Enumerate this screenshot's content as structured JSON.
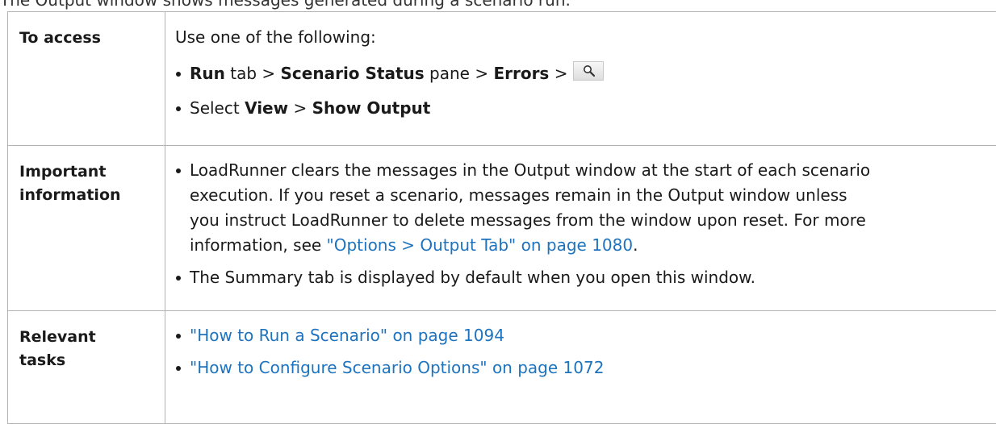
{
  "top_fragment": "The Output window shows messages generated during a scenario run.",
  "rows": {
    "access": {
      "label": "To access",
      "intro": "Use one of the following:",
      "path1": {
        "run": "Run",
        "tab_text": " tab > ",
        "scenario_status": "Scenario Status",
        "pane_text": " pane > ",
        "errors": "Errors",
        "sep": " > "
      },
      "path2": {
        "select": "Select ",
        "view": "View",
        "sep": " > ",
        "show_output": "Show Output"
      }
    },
    "important": {
      "label_1": "Important",
      "label_2": "information",
      "line_1": "LoadRunner clears the messages in the Output window at the start of each scenario",
      "line_2": "execution. If you reset a scenario, messages remain in the Output window unless",
      "line_3": "you instruct LoadRunner to delete messages from the window upon reset. For more",
      "line_4_prefix": "information, see ",
      "line_4_link": "\"Options > Output Tab\" on page 1080",
      "line_4_suffix": ".",
      "bullet_2": "The Summary tab is displayed by default when you open this window."
    },
    "tasks": {
      "label_1": "Relevant",
      "label_2": "tasks",
      "link_1": "\"How to Run a Scenario\" on page 1094",
      "link_2": "\"How to Configure Scenario Options\" on page 1072"
    }
  },
  "colors": {
    "link": "#1e73be",
    "border": "#b3b3b3"
  },
  "icons": {
    "errors_details_button": "magnifier-icon"
  }
}
